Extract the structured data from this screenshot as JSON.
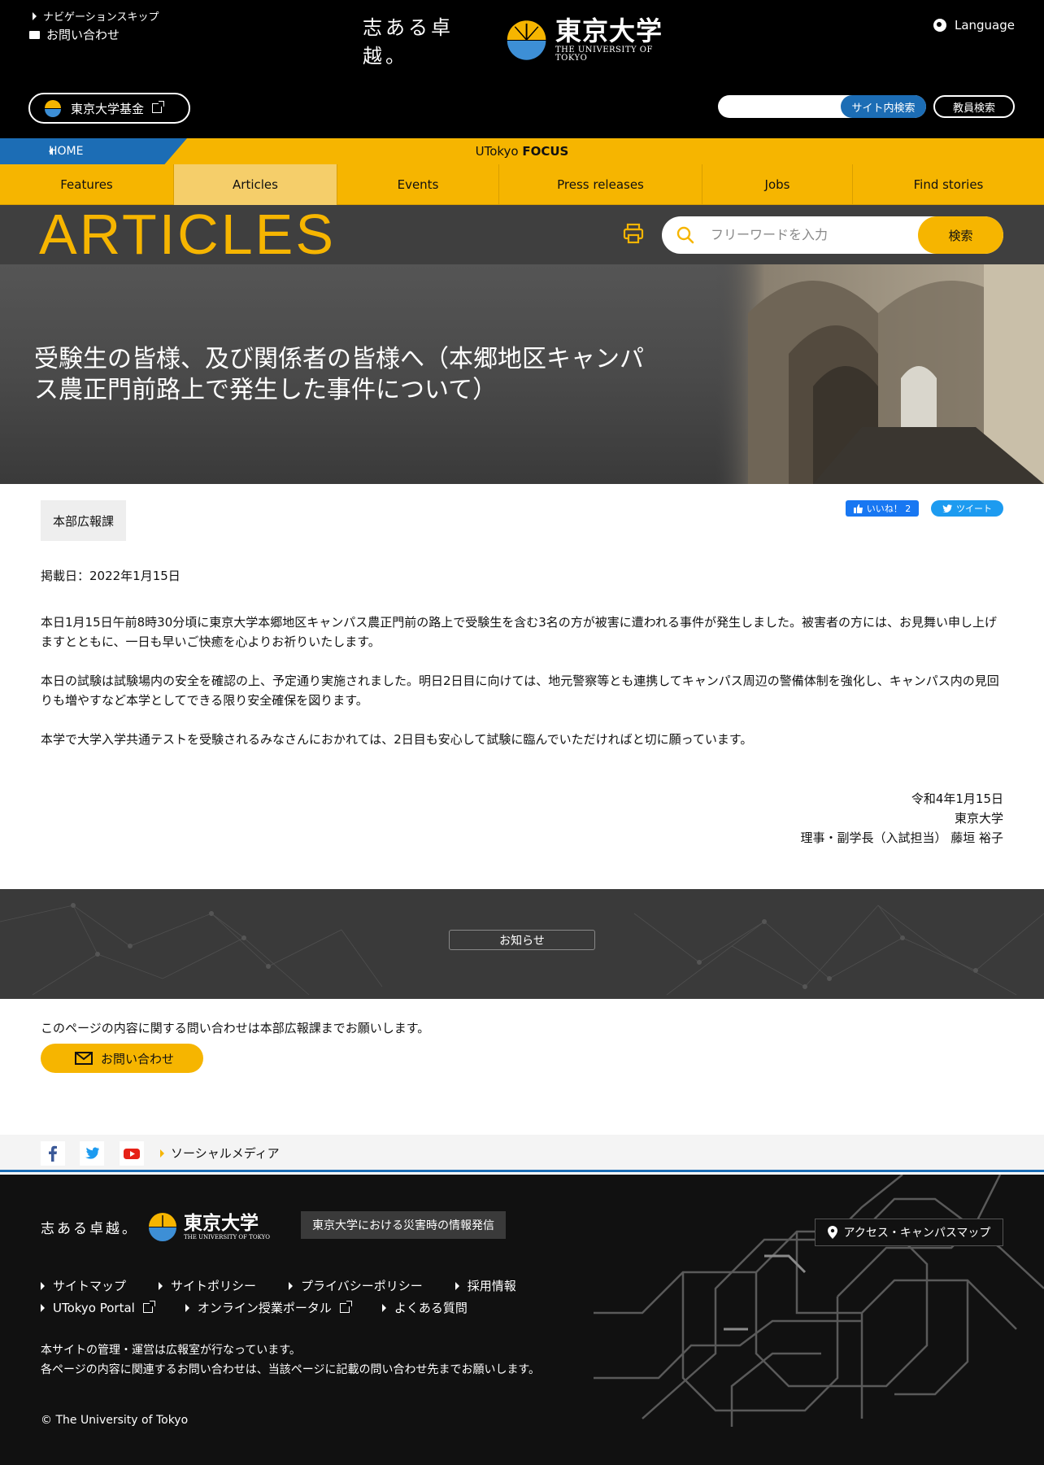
{
  "header": {
    "skip_nav": "ナビゲーションスキップ",
    "contact": "お問い合わせ",
    "logo_motto": "志ある卓越。",
    "logo_name_jp": "東京大学",
    "logo_name_en": "THE UNIVERSITY OF TOKYO",
    "language": "Language",
    "fund_button": "東京大学基金",
    "site_search_button": "サイト内検索",
    "staff_search_button": "教員検索",
    "site_search_placeholder": ""
  },
  "focus_bar": {
    "home": "HOME",
    "title_prefix": "UTokyo ",
    "title_bold": "FOCUS"
  },
  "nav": {
    "items": [
      {
        "label": "Features",
        "active": false
      },
      {
        "label": "Articles",
        "active": true
      },
      {
        "label": "Events",
        "active": false
      },
      {
        "label": "Press releases",
        "active": false
      },
      {
        "label": "Jobs",
        "active": false
      },
      {
        "label": "Find stories",
        "active": false
      }
    ]
  },
  "articles_band": {
    "title": "ARTICLES",
    "search_placeholder": "フリーワードを入力",
    "search_button": "検索"
  },
  "hero": {
    "title": "受験生の皆様、及び関係者の皆様へ（本郷地区キャンパス農正門前路上で発生した事件について）"
  },
  "article": {
    "department": "本部広報課",
    "like_label": "いいね！ 2",
    "tweet_label": "ツイート",
    "pub_date": "掲載日：2022年1月15日",
    "paragraphs": [
      "本日1月15日午前8時30分頃に東京大学本郷地区キャンパス農正門前の路上で受験生を含む3名の方が被害に遭われる事件が発生しました。被害者の方には、お見舞い申し上げますとともに、一日も早いご快癒を心よりお祈りいたします。",
      "本日の試験は試験場内の安全を確認の上、予定通り実施されました。明日2日目に向けては、地元警察等とも連携してキャンパス周辺の警備体制を強化し、キャンパス内の見回りも増やすなど本学としてできる限り安全確保を図ります。",
      "本学で大学入学共通テストを受験されるみなさんにおかれては、2日目も安心して試験に臨んでいただければと切に願っています。"
    ],
    "signature": [
      "令和4年1月15日",
      "東京大学",
      "理事・副学長（入試担当） 藤垣 裕子"
    ]
  },
  "notice": {
    "tag": "お知らせ"
  },
  "inquiry": {
    "text": "このページの内容に関する問い合わせは本部広報課までお願いします。",
    "button": "お問い合わせ"
  },
  "social": {
    "label": "ソーシャルメディア",
    "icons": [
      "facebook-icon",
      "twitter-icon",
      "youtube-icon"
    ]
  },
  "footer": {
    "logo_motto": "志ある卓越。",
    "logo_name_jp": "東京大学",
    "logo_name_en": "THE UNIVERSITY OF TOKYO",
    "disaster_button": "東京大学における災害時の情報発信",
    "access_button": "アクセス・キャンパスマップ",
    "links_row1": [
      "サイトマップ",
      "サイトポリシー",
      "プライバシーポリシー",
      "採用情報"
    ],
    "links_row2": [
      "UTokyo Portal",
      "オンライン授業ポータル",
      "よくある質問"
    ],
    "note_line1": "本サイトの管理・運営は広報室が行なっています。",
    "note_line2": "各ページの内容に関連するお問い合わせは、当該ページに記載の問い合わせ先までお願いします。",
    "copyright": "© The University of Tokyo"
  },
  "colors": {
    "brand_yellow": "#f6b500",
    "brand_blue": "#1c6db5",
    "header_bg": "#000000",
    "footer_bg": "#111111"
  }
}
